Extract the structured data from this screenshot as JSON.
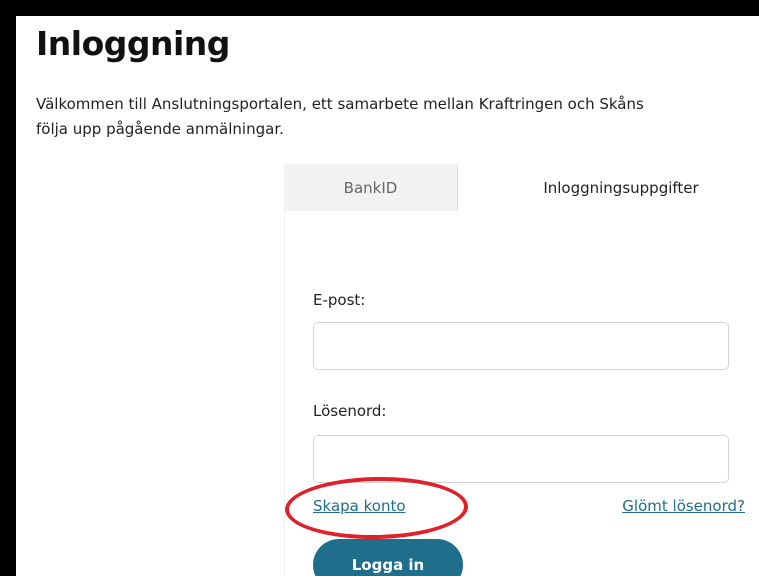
{
  "page": {
    "title": "Inloggning",
    "intro_line1": "Välkommen till Anslutningsportalen, ett samarbete mellan Kraftringen och Skåns",
    "intro_line2": "följa upp pågående anmälningar."
  },
  "login": {
    "tabs": [
      {
        "label": "BankID",
        "active": false
      },
      {
        "label": "Inloggningsuppgifter",
        "active": true
      }
    ],
    "email_label": "E-post:",
    "email_value": "",
    "password_label": "Lösenord:",
    "password_value": "",
    "create_account_link": "Skapa konto",
    "forgot_password_link": "Glömt lösenord?",
    "login_button": "Logga in"
  },
  "colors": {
    "accent": "#1f6e8c",
    "annotation": "#e0202a",
    "tab_inactive_bg": "#f2f2f2"
  }
}
